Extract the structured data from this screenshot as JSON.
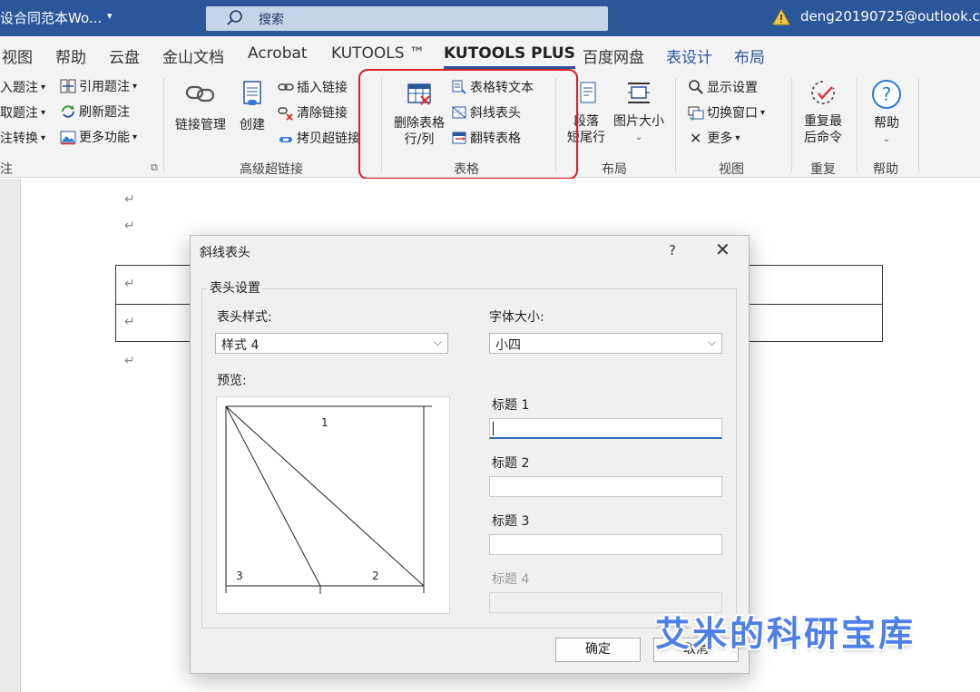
{
  "titlebar": {
    "doc_title": "设合同范本Wo...",
    "dropdown_glyph": "▾",
    "search_placeholder": "搜索",
    "account": "deng20190725@outlook.co"
  },
  "tabs": [
    {
      "label": "视图"
    },
    {
      "label": "帮助"
    },
    {
      "label": "云盘"
    },
    {
      "label": "金山文档"
    },
    {
      "label": "Acrobat"
    },
    {
      "label": "KUTOOLS ™"
    },
    {
      "label": "KUTOOLS PLUS"
    },
    {
      "label": "百度网盘"
    },
    {
      "label": "表设计"
    },
    {
      "label": "布局"
    }
  ],
  "ribbon": {
    "caption_group": {
      "items": [
        "入题注",
        "取题注",
        "注转换"
      ],
      "cross_ref": "引用题注",
      "refresh": "刷新题注",
      "more": "更多功能",
      "label": "注"
    },
    "hyperlink_group": {
      "manage": "链接管理",
      "create": "创建",
      "insert": "插入链接",
      "clear": "清除链接",
      "copy": "拷贝超链接",
      "label": "高级超链接"
    },
    "table_group": {
      "delete_line1": "删除表格",
      "delete_line2": "行/列",
      "to_text": "表格转文本",
      "diagonal": "斜线表头",
      "flip": "翻转表格",
      "label": "表格"
    },
    "layout_group": {
      "para_line1": "段落",
      "para_line2": "短尾行",
      "img_size": "图片大小",
      "label": "布局"
    },
    "view_group": {
      "display": "显示设置",
      "switch": "切换窗口",
      "more": "更多",
      "label": "视图"
    },
    "repeat_group": {
      "line1": "重复最",
      "line2": "后命令",
      "label": "重复"
    },
    "help_group": {
      "btn": "帮助",
      "label": "帮助"
    }
  },
  "document": {
    "para_mark": "↵"
  },
  "dialog": {
    "title": "斜线表头",
    "help": "?",
    "close": "✕",
    "group_title": "表头设置",
    "style_label": "表头样式:",
    "style_value": "样式 4",
    "font_label": "字体大小:",
    "font_value": "小四",
    "preview_label": "预览:",
    "preview_numbers": [
      "1",
      "2",
      "3"
    ],
    "title1_label": "标题 1",
    "title1_value": "",
    "title2_label": "标题 2",
    "title2_value": "",
    "title3_label": "标题 3",
    "title3_value": "",
    "title4_label": "标题 4",
    "title4_value": "",
    "ok": "确定",
    "cancel": "取消"
  },
  "watermark": "艾米的科研宝库",
  "colors": {
    "accent": "#2b579a",
    "highlight_box": "#e02020",
    "watermark": "#4d7fe6"
  }
}
